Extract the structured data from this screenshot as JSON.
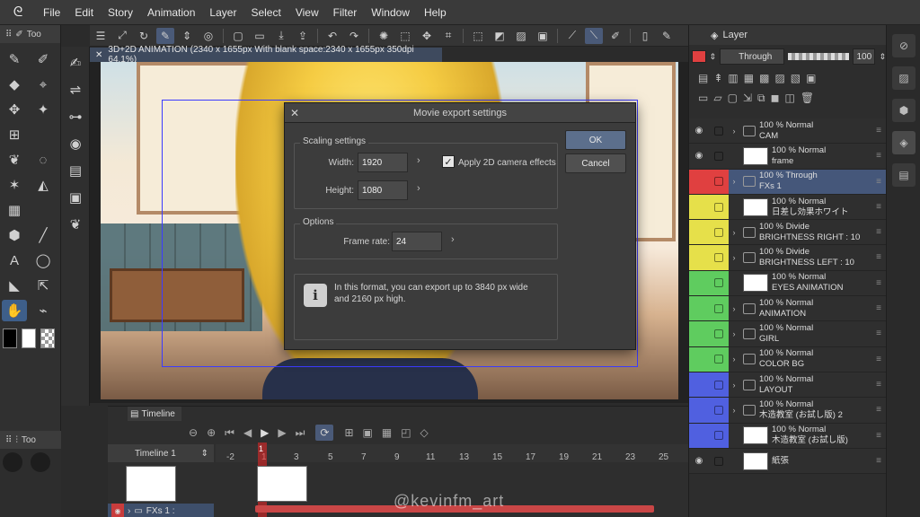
{
  "menu": {
    "items": [
      "File",
      "Edit",
      "Story",
      "Animation",
      "Layer",
      "Select",
      "View",
      "Filter",
      "Window",
      "Help"
    ]
  },
  "left_panel": {
    "tab_label": "Too",
    "sub_tab_label": "Too"
  },
  "canvas": {
    "tab_title": "3D+2D ANIMATION (2340 x 1655px With blank space:2340 x 1655px 350dpi 64.1%)"
  },
  "dialog": {
    "title": "Movie export settings",
    "scaling_group": "Scaling settings",
    "width_label": "Width:",
    "width_value": "1920",
    "height_label": "Height:",
    "height_value": "1080",
    "camera_label": "Apply 2D camera effects",
    "camera_checked": true,
    "options_group": "Options",
    "framerate_label": "Frame rate:",
    "framerate_value": "24",
    "info_line1": "In this format, you can export up to 3840 px wide",
    "info_line2": "and 2160 px high.",
    "ok_label": "OK",
    "cancel_label": "Cancel"
  },
  "timeline": {
    "tab_label": "Timeline",
    "name": "Timeline 1",
    "ticks": [
      "-2",
      "1",
      "3",
      "5",
      "7",
      "9",
      "11",
      "13",
      "15",
      "17",
      "19",
      "21",
      "23",
      "25"
    ],
    "current_frame": "1",
    "row_label": "FXs 1 :",
    "watermark": "@kevinfm_art"
  },
  "layer_panel": {
    "tab_label": "Layer",
    "blend_mode": "Through",
    "opacity": "100",
    "layers": [
      {
        "line1": "100 % Normal",
        "line2": "CAM",
        "thumb": "folder",
        "color": "",
        "selected": false
      },
      {
        "line1": "100 % Normal",
        "line2": "frame",
        "thumb": "image",
        "color": "",
        "selected": false
      },
      {
        "line1": "100 % Through",
        "line2": "FXs 1",
        "thumb": "folder",
        "color": "#e04040",
        "selected": true
      },
      {
        "line1": "100 % Normal",
        "line2": "日差し効果ホワイト",
        "thumb": "image",
        "color": "#e6e04a",
        "selected": false
      },
      {
        "line1": "100 % Divide",
        "line2": "BRIGHTNESS RIGHT : 10",
        "thumb": "folder",
        "color": "#e6e04a",
        "selected": false
      },
      {
        "line1": "100 % Divide",
        "line2": "BRIGHTNESS LEFT : 10",
        "thumb": "folder",
        "color": "#e6e04a",
        "selected": false
      },
      {
        "line1": "100 % Normal",
        "line2": "EYES ANIMATION",
        "thumb": "image",
        "color": "#5fcc5f",
        "selected": false
      },
      {
        "line1": "100 % Normal",
        "line2": "ANIMATION",
        "thumb": "folder",
        "color": "#5fcc5f",
        "selected": false
      },
      {
        "line1": "100 % Normal",
        "line2": "GIRL",
        "thumb": "folder",
        "color": "#5fcc5f",
        "selected": false
      },
      {
        "line1": "100 % Normal",
        "line2": "COLOR BG",
        "thumb": "folder",
        "color": "#5fcc5f",
        "selected": false
      },
      {
        "line1": "100 % Normal",
        "line2": "LAYOUT",
        "thumb": "folder",
        "color": "#5060e0",
        "selected": false
      },
      {
        "line1": "100 % Normal",
        "line2": "木造教室 (お試し版) 2",
        "thumb": "folder",
        "color": "#5060e0",
        "selected": false
      },
      {
        "line1": "100 % Normal",
        "line2": "木造教室 (お試し版)",
        "thumb": "image",
        "color": "#5060e0",
        "selected": false
      },
      {
        "line1": "",
        "line2": "紙張",
        "thumb": "image",
        "color": "",
        "selected": false
      }
    ]
  },
  "colors": {
    "accent": "#5c6f8c",
    "selection_red": "#e04040"
  }
}
